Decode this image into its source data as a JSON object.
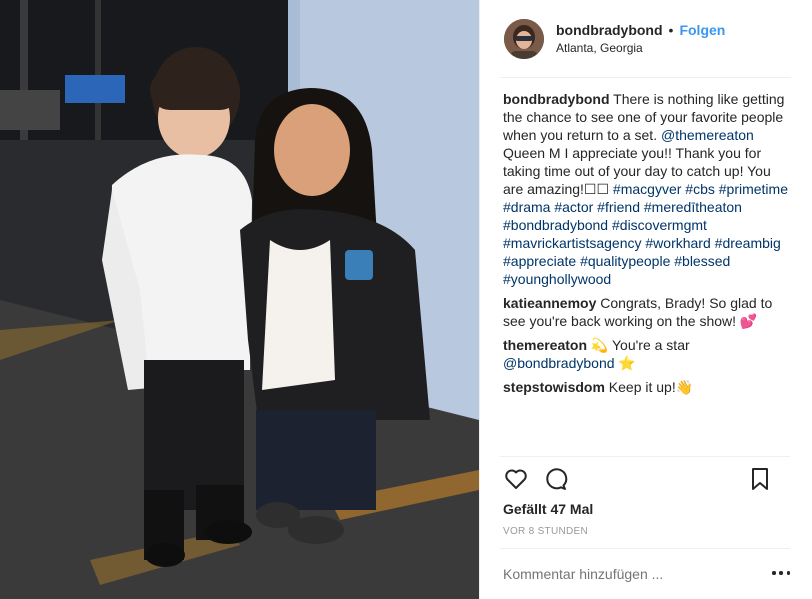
{
  "post": {
    "username": "bondbradybond",
    "separator": "•",
    "follow_label": "Folgen",
    "location": "Atlanta, Georgia",
    "photo_alt": ""
  },
  "caption": {
    "username": "bondbradybond",
    "text_1": " There is nothing like getting the chance to see one of your favorite people when you return to a set. ",
    "mention": "@themereaton",
    "text_2": " Queen M I appreciate you!! Thank you for taking time out of your day to catch up! You are amazing!☐☐ ",
    "hashtags": [
      "#macgyver",
      "#cbs",
      "#primetime",
      "#drama",
      "#actor",
      "#friend",
      "#meredītheaton",
      "#bondbradybond",
      "#discovermgmt",
      "#mavrickartistsagency",
      "#workhard",
      "#dreambig",
      "#appreciate",
      "#qualitypeople",
      "#blessed",
      "#younghollywood"
    ]
  },
  "comments": [
    {
      "username": "katieannemoy",
      "text": " Congrats, Brady! So glad to see you're back working on the show! ",
      "emoji": "💕"
    },
    {
      "username": "themereaton",
      "text": " 💫 You're a star ",
      "mention": "@bondbradybond",
      "tail": " ⭐"
    },
    {
      "username": "stepstowisdom",
      "text": " Keep it up!",
      "emoji": "👋"
    }
  ],
  "engagement": {
    "likes": "Gefällt 47 Mal",
    "time": "VOR 8 STUNDEN"
  },
  "comment_box": {
    "placeholder": "Kommentar hinzufügen ..."
  },
  "icons": {
    "like": "heart-icon",
    "comment": "comment-icon",
    "save": "bookmark-icon",
    "more": "more-options-icon"
  },
  "colors": {
    "link": "#003569",
    "follow": "#3897f0",
    "meta": "#999999"
  }
}
